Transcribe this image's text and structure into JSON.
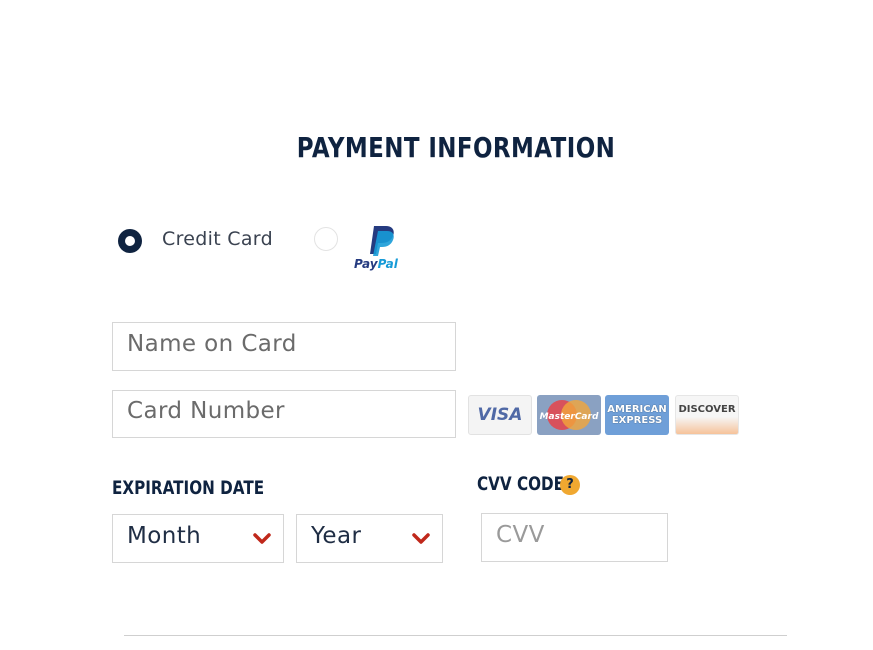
{
  "page": {
    "title": "PAYMENT INFORMATION"
  },
  "payment_method": {
    "options": [
      {
        "label": "Credit Card",
        "selected": true
      },
      {
        "label": "PayPal",
        "selected": false
      }
    ],
    "paypal_logo": {
      "text_pay": "Pay",
      "text_pal": "Pal"
    }
  },
  "fields": {
    "name_on_card": {
      "placeholder": "Name on Card",
      "value": ""
    },
    "card_number": {
      "placeholder": "Card Number",
      "value": ""
    },
    "cvv": {
      "placeholder": "CVV",
      "value": ""
    }
  },
  "card_logos": [
    {
      "name": "visa",
      "text": "VISA"
    },
    {
      "name": "mastercard",
      "text": "MasterCard"
    },
    {
      "name": "american-express",
      "text": "AMERICAN EXPRESS"
    },
    {
      "name": "discover",
      "text": "DISCOVER"
    }
  ],
  "expiration": {
    "label": "EXPIRATION DATE",
    "month": {
      "selected": "Month"
    },
    "year": {
      "selected": "Year"
    }
  },
  "cvv_section": {
    "label": "CVV CODE",
    "help_icon": "?"
  },
  "colors": {
    "navy": "#0f2340",
    "accent_chevron": "#c0281b",
    "help_badge": "#f0a830"
  },
  "icons": [
    "radio-selected-icon",
    "radio-unselected-icon",
    "paypal-logo-icon",
    "chevron-down-icon",
    "question-icon"
  ]
}
